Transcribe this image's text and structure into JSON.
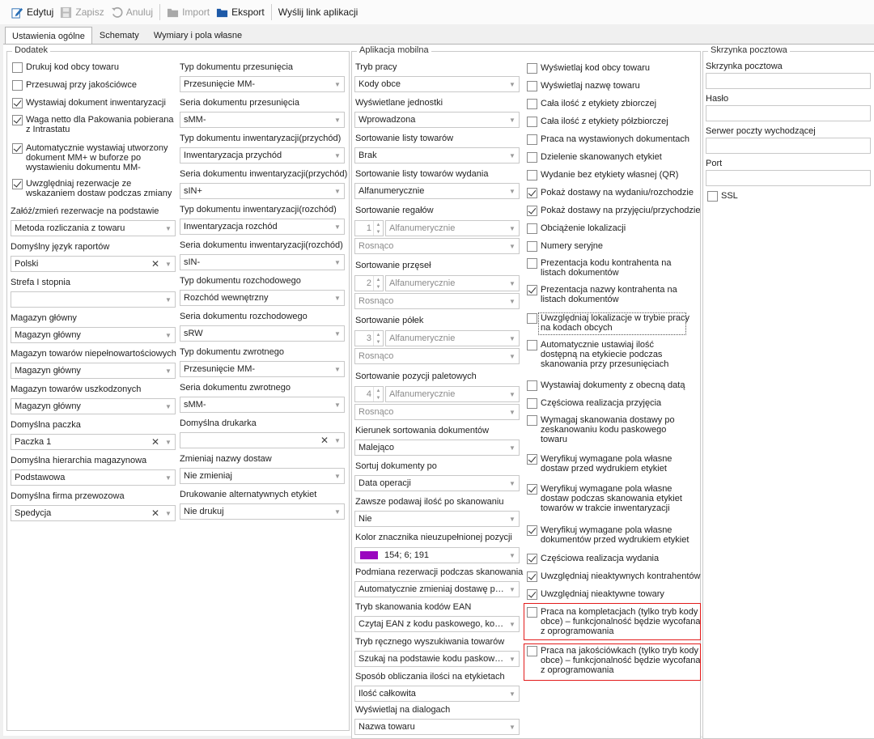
{
  "toolbar": {
    "edit": "Edytuj",
    "save": "Zapisz",
    "cancel": "Anuluj",
    "import": "Import",
    "export": "Eksport",
    "send_link": "Wyślij link aplikacji"
  },
  "tabs": [
    "Ustawienia ogólne",
    "Schematy",
    "Wymiary i pola własne"
  ],
  "dodatek": {
    "title": "Dodatek",
    "checkboxes": [
      {
        "label": "Drukuj kod obcy towaru",
        "checked": false
      },
      {
        "label": "Przesuwaj przy jakościówce",
        "checked": false
      },
      {
        "label": "Wystawiaj dokument inwentaryzacji",
        "checked": true
      },
      {
        "label": "Waga netto dla Pakowania pobierana\nz Intrastatu",
        "checked": true
      },
      {
        "label": "Automatycznie wystawiaj utworzony\ndokument MM+ w buforze po\nwystawieniu dokumentu MM-",
        "checked": true
      },
      {
        "label": "Uwzględniaj rezerwacje ze\nwskazaniem dostaw podczas zmiany",
        "checked": true
      }
    ],
    "left_fields": [
      {
        "label": "Załóż/zmień rezerwacje na podstawie",
        "value": "Metoda rozliczania z towaru",
        "clear": false
      },
      {
        "label": "Domyślny język raportów",
        "value": "Polski",
        "clear": true
      },
      {
        "label": "Strefa I stopnia",
        "value": "",
        "clear": false
      },
      {
        "label": "Magazyn główny",
        "value": "Magazyn główny",
        "clear": false
      },
      {
        "label": "Magazyn towarów niepełnowartościowych",
        "value": "Magazyn główny",
        "clear": false
      },
      {
        "label": "Magazyn towarów uszkodzonych",
        "value": "Magazyn główny",
        "clear": false
      },
      {
        "label": "Domyślna paczka",
        "value": "Paczka 1",
        "clear": true
      },
      {
        "label": "Domyślna hierarchia magazynowa",
        "value": "Podstawowa",
        "clear": false
      },
      {
        "label": "Domyślna firma przewozowa",
        "value": "Spedycja",
        "clear": true
      }
    ],
    "right_fields": [
      {
        "label": "Typ dokumentu przesunięcia",
        "value": "Przesunięcie MM-",
        "clear": false
      },
      {
        "label": "Seria dokumentu przesunięcia",
        "value": "sMM-",
        "clear": false
      },
      {
        "label": "Typ dokumentu inwentaryzacji(przychód)",
        "value": "Inwentaryzacja przychód",
        "clear": false
      },
      {
        "label": "Seria dokumentu inwentaryzacji(przychód)",
        "value": "sIN+",
        "clear": false
      },
      {
        "label": "Typ dokumentu inwentaryzacji(rozchód)",
        "value": "Inwentaryzacja rozchód",
        "clear": false
      },
      {
        "label": "Seria dokumentu inwentaryzacji(rozchód)",
        "value": "sIN-",
        "clear": false
      },
      {
        "label": "Typ dokumentu rozchodowego",
        "value": "Rozchód wewnętrzny",
        "clear": false
      },
      {
        "label": "Seria dokumentu rozchodowego",
        "value": "sRW",
        "clear": false
      },
      {
        "label": "Typ dokumentu zwrotnego",
        "value": "Przesunięcie MM-",
        "clear": false
      },
      {
        "label": "Seria dokumentu zwrotnego",
        "value": "sMM-",
        "clear": false
      },
      {
        "label": "Domyślna drukarka",
        "value": "",
        "clear": true
      },
      {
        "label": "Zmieniaj nazwy dostaw",
        "value": "Nie zmieniaj",
        "clear": false
      },
      {
        "label": "Drukowanie alternatywnych etykiet",
        "value": "Nie drukuj",
        "clear": false
      }
    ]
  },
  "mobile": {
    "title": "Aplikacja mobilna",
    "fields_a": [
      {
        "label": "Tryb pracy",
        "value": "Kody obce"
      },
      {
        "label": "Wyświetlane jednostki",
        "value": "Wprowadzona"
      },
      {
        "label": "Sortowanie listy towarów",
        "value": "Brak"
      },
      {
        "label": "Sortowanie listy towarów wydania",
        "value": "Alfanumerycznie"
      }
    ],
    "sort_blocks": [
      {
        "label": "Sortowanie regałów",
        "num": "1",
        "mode": "Alfanumerycznie",
        "order": "Rosnąco"
      },
      {
        "label": "Sortowanie przęseł",
        "num": "2",
        "mode": "Alfanumerycznie",
        "order": "Rosnąco"
      },
      {
        "label": "Sortowanie półek",
        "num": "3",
        "mode": "Alfanumerycznie",
        "order": "Rosnąco"
      },
      {
        "label": "Sortowanie pozycji paletowych",
        "num": "4",
        "mode": "Alfanumerycznie",
        "order": "Rosnąco"
      }
    ],
    "fields_b": [
      {
        "label": "Kierunek sortowania dokumentów",
        "value": "Malejąco"
      },
      {
        "label": "Sortuj dokumenty po",
        "value": "Data operacji"
      },
      {
        "label": "Zawsze podawaj ilość po skanowaniu",
        "value": "Nie"
      }
    ],
    "color_field": {
      "label": "Kolor znacznika nieuzupełnionej pozycji",
      "value": "154; 6; 191",
      "swatch": "#9a06bf"
    },
    "fields_c": [
      {
        "label": "Podmiana rezerwacji podczas skanowania",
        "value": "Automatycznie zmieniaj dostawę po..."
      },
      {
        "label": "Tryb skanowania kodów EAN",
        "value": "Czytaj EAN z kodu paskowego, kod..."
      },
      {
        "label": "Tryb ręcznego wyszukiwania towarów",
        "value": "Szukaj na podstawie kodu paskowe..."
      },
      {
        "label": "Sposób obliczania ilości na etykietach",
        "value": "Ilość całkowita"
      },
      {
        "label": "Wyświetlaj na dialogach",
        "value": "Nazwa towaru"
      }
    ],
    "checkboxes": [
      {
        "label": "Wyświetlaj kod obcy towaru",
        "checked": false
      },
      {
        "label": "Wyświetlaj nazwę towaru",
        "checked": false
      },
      {
        "label": "Cała ilość z etykiety zbiorczej",
        "checked": false
      },
      {
        "label": "Cała ilość z etykiety półzbiorczej",
        "checked": false
      },
      {
        "label": "Praca na wystawionych dokumentach",
        "checked": false
      },
      {
        "label": "Dzielenie skanowanych etykiet",
        "checked": false
      },
      {
        "label": "Wydanie bez etykiety własnej (QR)",
        "checked": false
      },
      {
        "label": "Pokaż dostawy na wydaniu/rozchodzie",
        "checked": true
      },
      {
        "label": "Pokaż dostawy na przyjęciu/przychodzie",
        "checked": true
      },
      {
        "label": "Obciążenie lokalizacji",
        "checked": false
      },
      {
        "label": "Numery seryjne",
        "checked": false
      },
      {
        "label": "Prezentacja kodu kontrahenta na\nlistach dokumentów",
        "checked": false
      },
      {
        "label": "Prezentacja nazwy kontrahenta na\nlistach dokumentów",
        "checked": true
      },
      {
        "label": "Uwzględniaj lokalizacje w trybie pracy\nna kodach obcych",
        "checked": false
      },
      {
        "label": "Automatycznie ustawiaj ilość\ndostępną na etykiecie podczas\nskanowania przy przesunięciach",
        "checked": false
      },
      {
        "label": "Wystawiaj dokumenty z obecną datą",
        "checked": false
      },
      {
        "label": "Częściowa realizacja przyjęcia",
        "checked": false
      },
      {
        "label": "Wymagaj skanowania dostawy po\nzeskanowaniu kodu paskowego\ntowaru",
        "checked": false
      },
      {
        "label": "Weryfikuj wymagane pola własne\ndostaw przed wydrukiem etykiet",
        "checked": true
      },
      {
        "label": "Weryfikuj wymagane pola własne\ndostaw podczas skanowania etykiet\ntowarów w trakcie inwentaryzacji",
        "checked": true
      },
      {
        "label": "Weryfikuj wymagane pola własne\ndokumentów przed wydrukiem etykiet",
        "checked": true
      },
      {
        "label": "Częściowa realizacja wydania",
        "checked": true
      },
      {
        "label": "Uwzględniaj nieaktywnych kontrahentów",
        "checked": true
      },
      {
        "label": "Uwzględniaj nieaktywne towary",
        "checked": true
      },
      {
        "label": "Praca na kompletacjach (tylko tryb kody\nobce) – funkcjonalność będzie wycofana\nz oprogramowania",
        "checked": false
      },
      {
        "label": "Praca na jakościówkach (tylko tryb kody\nobce) – funkcjonalność będzie wycofana\nz oprogramowania",
        "checked": false
      }
    ]
  },
  "mailbox": {
    "title": "Skrzynka pocztowa",
    "fields": [
      "Skrzynka pocztowa",
      "Hasło",
      "Serwer poczty wychodzącej",
      "Port"
    ],
    "ssl": {
      "label": "SSL",
      "checked": false
    }
  }
}
